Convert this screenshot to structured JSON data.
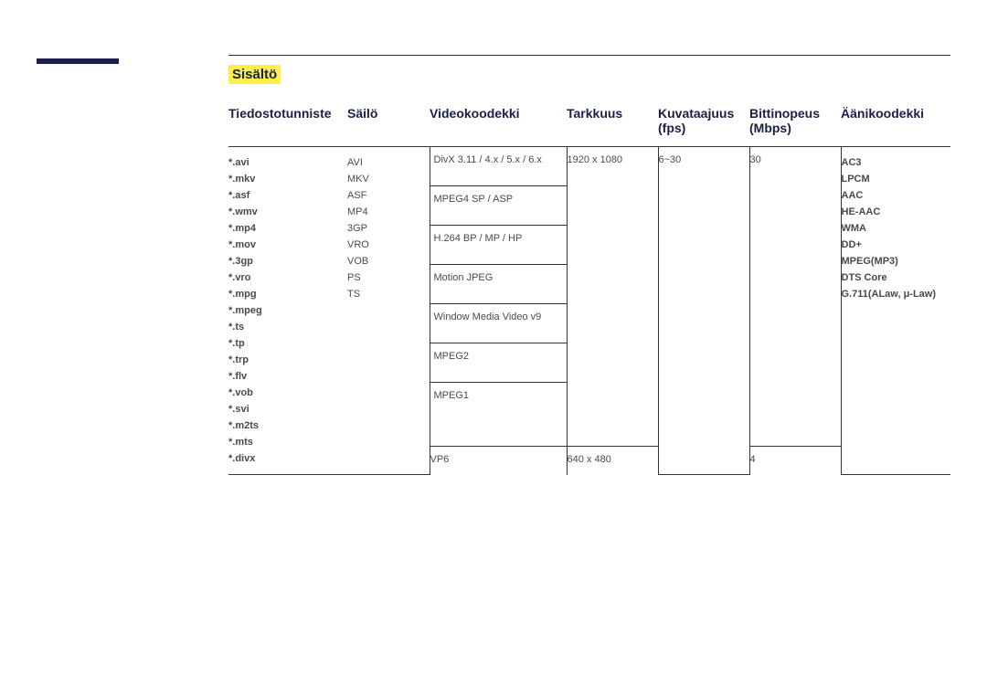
{
  "section_label": "Sisältö",
  "headers": {
    "ext": "Tiedostotunniste",
    "container": "Säilö",
    "vcodec": "Videokoodekki",
    "res": "Tarkkuus",
    "fps": "Kuvataajuus (fps)",
    "bitrate": "Bittinopeus (Mbps)",
    "acodec": "Äänikoodekki"
  },
  "extensions": [
    "*.avi",
    "*.mkv",
    "*.asf",
    "*.wmv",
    "*.mp4",
    "*.mov",
    "*.3gp",
    "*.vro",
    "*.mpg",
    "*.mpeg",
    "*.ts",
    "*.tp",
    "*.trp",
    "*.flv",
    "*.vob",
    "*.svi",
    "*.m2ts",
    "*.mts",
    "*.divx"
  ],
  "containers": [
    "AVI",
    "MKV",
    "ASF",
    "MP4",
    "3GP",
    "VRO",
    "VOB",
    "PS",
    "TS"
  ],
  "vcodecs_main": [
    "DivX 3.11 / 4.x / 5.x / 6.x",
    "MPEG4 SP / ASP",
    "H.264 BP / MP / HP",
    "Motion JPEG",
    "Window Media Video v9",
    "MPEG2",
    "MPEG1"
  ],
  "vcodec_vp6": "VP6",
  "res_main": "1920 x 1080",
  "res_vp6": "640 x 480",
  "fps_main": "6~30",
  "bit_main": "30",
  "bit_vp6": "4",
  "acodecs": [
    "AC3",
    "LPCM",
    "AAC",
    "HE-AAC",
    "WMA",
    "DD+",
    "MPEG(MP3)",
    "DTS Core",
    "G.711(ALaw, μ-Law)"
  ]
}
